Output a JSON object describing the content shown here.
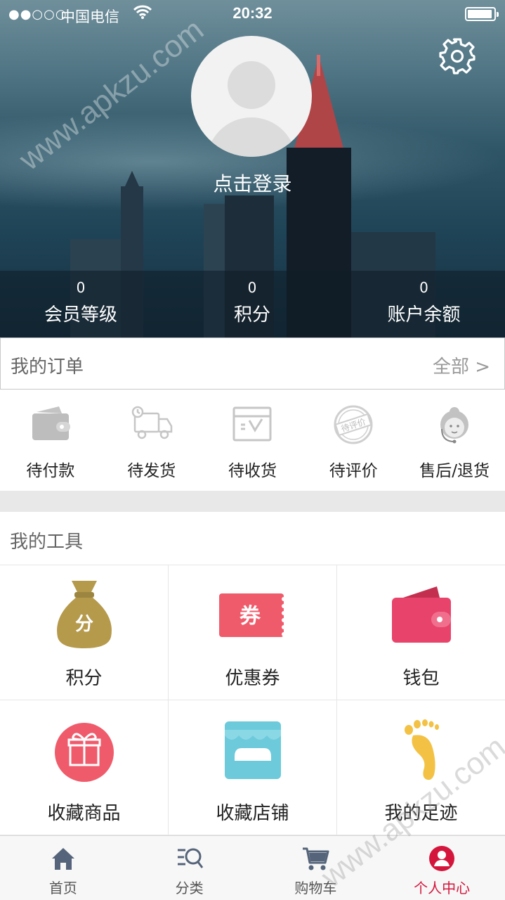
{
  "status_bar": {
    "signal": "●●○○○",
    "carrier": "中国电信",
    "time": "20:32",
    "battery_level": 0.9
  },
  "profile": {
    "login_text": "点击登录",
    "settings_icon": "gear-icon",
    "avatar_icon": "user-placeholder-icon"
  },
  "stats": [
    {
      "value": "0",
      "label": "会员等级"
    },
    {
      "value": "0",
      "label": "积分"
    },
    {
      "value": "0",
      "label": "账户余额"
    }
  ],
  "orders": {
    "title": "我的订单",
    "all_label": "全部 >",
    "items": [
      {
        "label": "待付款",
        "icon": "wallet-icon"
      },
      {
        "label": "待发货",
        "icon": "truck-icon"
      },
      {
        "label": "待收货",
        "icon": "box-icon"
      },
      {
        "label": "待评价",
        "icon": "review-stamp-icon"
      },
      {
        "label": "售后/退货",
        "icon": "customer-service-icon"
      }
    ],
    "review_stamp_text": "待评价"
  },
  "tools": {
    "title": "我的工具",
    "items": [
      {
        "label": "积分",
        "icon": "points-bag-icon",
        "icon_text": "分",
        "color": "#b59a4c"
      },
      {
        "label": "优惠券",
        "icon": "coupon-icon",
        "icon_text": "券",
        "color": "#ef5b6b"
      },
      {
        "label": "钱包",
        "icon": "wallet-icon",
        "color": "#e8436a"
      },
      {
        "label": "收藏商品",
        "icon": "gift-icon",
        "color": "#ef5b6b"
      },
      {
        "label": "收藏店铺",
        "icon": "store-icon",
        "color": "#6ccadb"
      },
      {
        "label": "我的足迹",
        "icon": "footprint-icon",
        "color": "#f3c244"
      }
    ]
  },
  "tabbar": {
    "items": [
      {
        "label": "首页",
        "icon": "home-icon",
        "active": false
      },
      {
        "label": "分类",
        "icon": "category-search-icon",
        "active": false
      },
      {
        "label": "购物车",
        "icon": "cart-icon",
        "active": false
      },
      {
        "label": "个人中心",
        "icon": "user-icon",
        "active": true
      }
    ],
    "active_color": "#d4163c"
  },
  "watermark": "www.apkzu.com"
}
